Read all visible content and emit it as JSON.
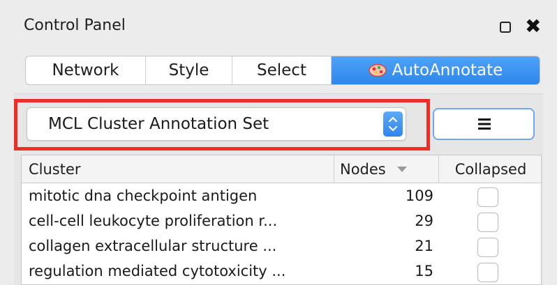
{
  "panel": {
    "title": "Control Panel"
  },
  "tabs": [
    {
      "label": "Network"
    },
    {
      "label": "Style"
    },
    {
      "label": "Select"
    },
    {
      "label": "AutoAnnotate",
      "icon": "autoannotate-icon"
    }
  ],
  "active_tab": "AutoAnnotate",
  "annotation_set": {
    "selected": "MCL Cluster Annotation Set",
    "menu_icon": "hamburger-menu-icon"
  },
  "table": {
    "columns": [
      "Cluster",
      "Nodes",
      "Collapsed"
    ],
    "sort_column": "Nodes",
    "sort_direction": "descending",
    "rows": [
      {
        "cluster": "mitotic dna checkpoint antigen",
        "nodes": "109",
        "collapsed": false
      },
      {
        "cluster": "cell-cell leukocyte proliferation r...",
        "nodes": "29",
        "collapsed": false
      },
      {
        "cluster": "collagen extracellular structure ...",
        "nodes": "21",
        "collapsed": false
      },
      {
        "cluster": "regulation mediated cytotoxicity ...",
        "nodes": "15",
        "collapsed": false
      }
    ]
  },
  "colors": {
    "accent": "#2f86ec",
    "highlight": "#ee2e24"
  }
}
